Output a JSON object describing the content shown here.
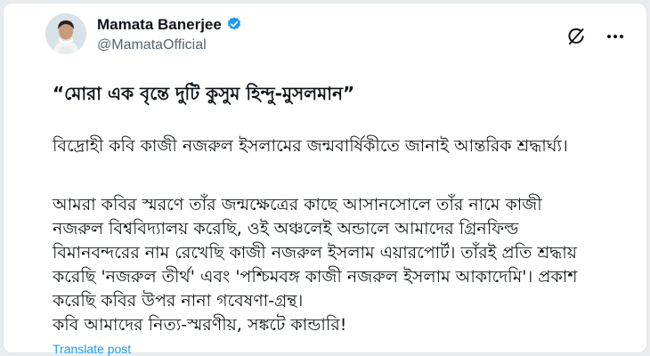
{
  "tweet": {
    "author_name": "Mamata Banerjee",
    "author_handle": "@MamataOfficial",
    "heading": "“মোরা এক বৃন্তে দুটি কুসুম হিন্দু-মুসলমান”",
    "paragraphs": [
      "বিদ্রোহী কবি কাজী নজরুল ইসলামের জন্মবার্ষিকীতে জানাই আন্তরিক শ্রদ্ধার্ঘ্য।",
      "আমরা কবির স্মরণে তাঁর জন্মক্ষেত্রের কাছে আসানসোলে তাঁর নামে কাজী\nনজরুল বিশ্ববিদ্যালয় করেছি, ওই অঞ্চলেই অন্ডালে আমাদের গ্রিনফিল্ড\nবিমানবন্দরের নাম রেখেছি কাজী নজরুল ইসলাম এয়ারপোর্ট। তাঁরই প্রতি শ্রদ্ধায়\nকরেছি 'নজরুল তীর্থ' এবং 'পশ্চিমবঙ্গ কাজী নজরুল ইসলাম আকাদেমি'। প্রকাশ\nকরেছি কবির উপর নানা গবেষণা-গ্রন্থ।",
      "কবি আমাদের নিত্য-স্মরণীয়, সঙ্কটে কান্ডারি!"
    ],
    "translate_label": "Translate post"
  },
  "icons": {
    "verified": "verified-badge-icon",
    "grok": "grok-icon",
    "more": "more-options-icon"
  },
  "colors": {
    "accent": "#1d9bf0",
    "text": "#0f1419",
    "secondary": "#536471"
  }
}
